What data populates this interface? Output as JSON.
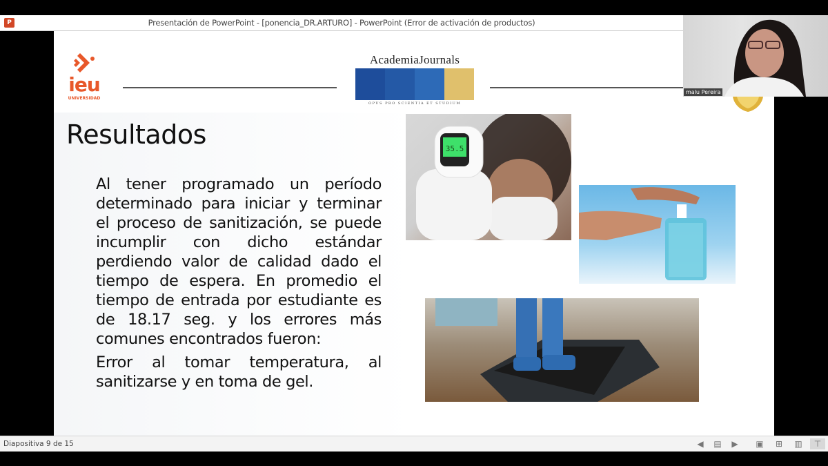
{
  "window": {
    "app_icon": "powerpoint-icon",
    "title": "Presentación de PowerPoint - [ponencia_DR.ARTURO] - PowerPoint (Error de activación de productos)"
  },
  "slide": {
    "logos": {
      "left": {
        "text": "ieu",
        "subtext": "UNIVERSIDAD",
        "color": "#e8582a"
      },
      "center": {
        "name": "AcademiaJournals",
        "motto": "OPUS PRO SCIENTIA ET STUDIUM",
        "bar_colors": [
          "#1e4d9b",
          "#2459a6",
          "#2d6ab7",
          "#e0c06c"
        ]
      }
    },
    "title": "Resultados",
    "paragraphs": [
      "Al tener programado un período determinado para iniciar y terminar el proceso de sanitización, se puede incumplir con dicho estándar perdiendo valor de calidad dado el tiempo de espera. En promedio el tiempo de entrada por estudiante es de 18.17 seg. y los errores más comunes encontrados fueron:",
      "Error al tomar temperatura, al sanitizarse y en toma de gel."
    ],
    "images": [
      {
        "name": "thermometer-photo",
        "thermometer_reading": "35.5"
      },
      {
        "name": "hand-sanitizer-photo"
      },
      {
        "name": "sanitizing-mat-photo"
      }
    ]
  },
  "webcam": {
    "participant_name": "malu Pereira"
  },
  "statusbar": {
    "slide_counter": "Diapositiva 9 de 15",
    "icons": [
      "previous-icon",
      "notes-icon",
      "next-icon",
      "normal-view-icon",
      "slide-sorter-icon",
      "reading-view-icon",
      "slideshow-icon"
    ]
  }
}
